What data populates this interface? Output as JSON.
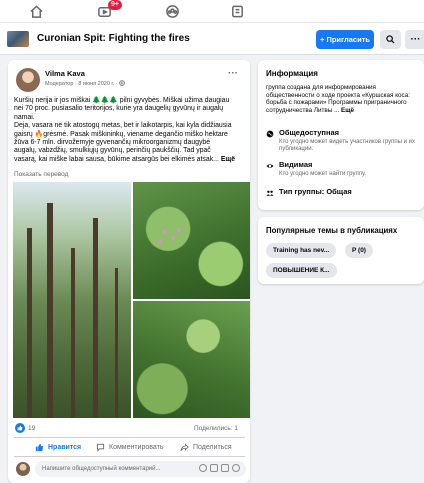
{
  "nav": {
    "notification_badge": "9+",
    "icons": [
      "home-icon",
      "watch-icon",
      "groups-icon",
      "gaming-icon"
    ]
  },
  "group_header": {
    "title": "Curonian Spit: Fighting the fires",
    "invite_label": "+ Пригласить",
    "more_label": "···"
  },
  "post": {
    "author": "Vilma Kava",
    "meta": "Модератор · 8 июня 2020 г. · ",
    "more_label": "···",
    "text_lines": [
      "Kuršių nerija ir jos miškai 🌲🌲🌲 pilni gyvybės. Miškai užima daugiau",
      "nei 70 proc. pusiasalio teritorijos, kurie yra daugelių gyvūnų ir augalų",
      "namai.",
      "Deja, vasara ne tik atostogų metas, bet ir laikotarpis, kai kyla didžiausia",
      "gaisrų 🔥grėsmė. Pasak miškininkų, viename degančio miško hektare",
      "žūva 6-7 mln. dirvožemyje gyvenančių mikroorganizmų daugybė",
      "augalų, vabzdžių, smulkiųjų gyvūnų, perinčių paukščių. Tad ypač"
    ],
    "text_last": "vasarą, kai miške labai sausa, būkime atsargūs  bei elkimės atsak... ",
    "see_more": "Ещё",
    "translate": "Показать перевод",
    "reaction_count": "19",
    "shares": "Поделились: 1",
    "like_label": "Нравится",
    "comment_label": "Комментировать",
    "share_label": "Поделиться",
    "comment_placeholder": "Напишите общедоступный комментарий..."
  },
  "info": {
    "title": "Информация",
    "description": "группа создана для информирования общественности о ходе проекта «Куршская коса: борьба с пожарами» Программы приграничного сотрудничества Литвы ... ",
    "see_more": "Ещё",
    "public_title": "Общедоступная",
    "public_desc": "Кто угодно может видеть участников группы и их публикации.",
    "visible_title": "Видимая",
    "visible_desc": "Кто угодно может найти группу.",
    "type_title": "Тип группы: Общая"
  },
  "topics": {
    "title": "Популярные темы в публикациях",
    "chips": [
      "Training has nev...",
      "P (0)",
      "ПОВЫШЕНИЕ К..."
    ]
  },
  "colors": {
    "brand_blue": "#1877f2",
    "badge_red": "#e41e3f",
    "page_bg": "#f0f2f5"
  }
}
